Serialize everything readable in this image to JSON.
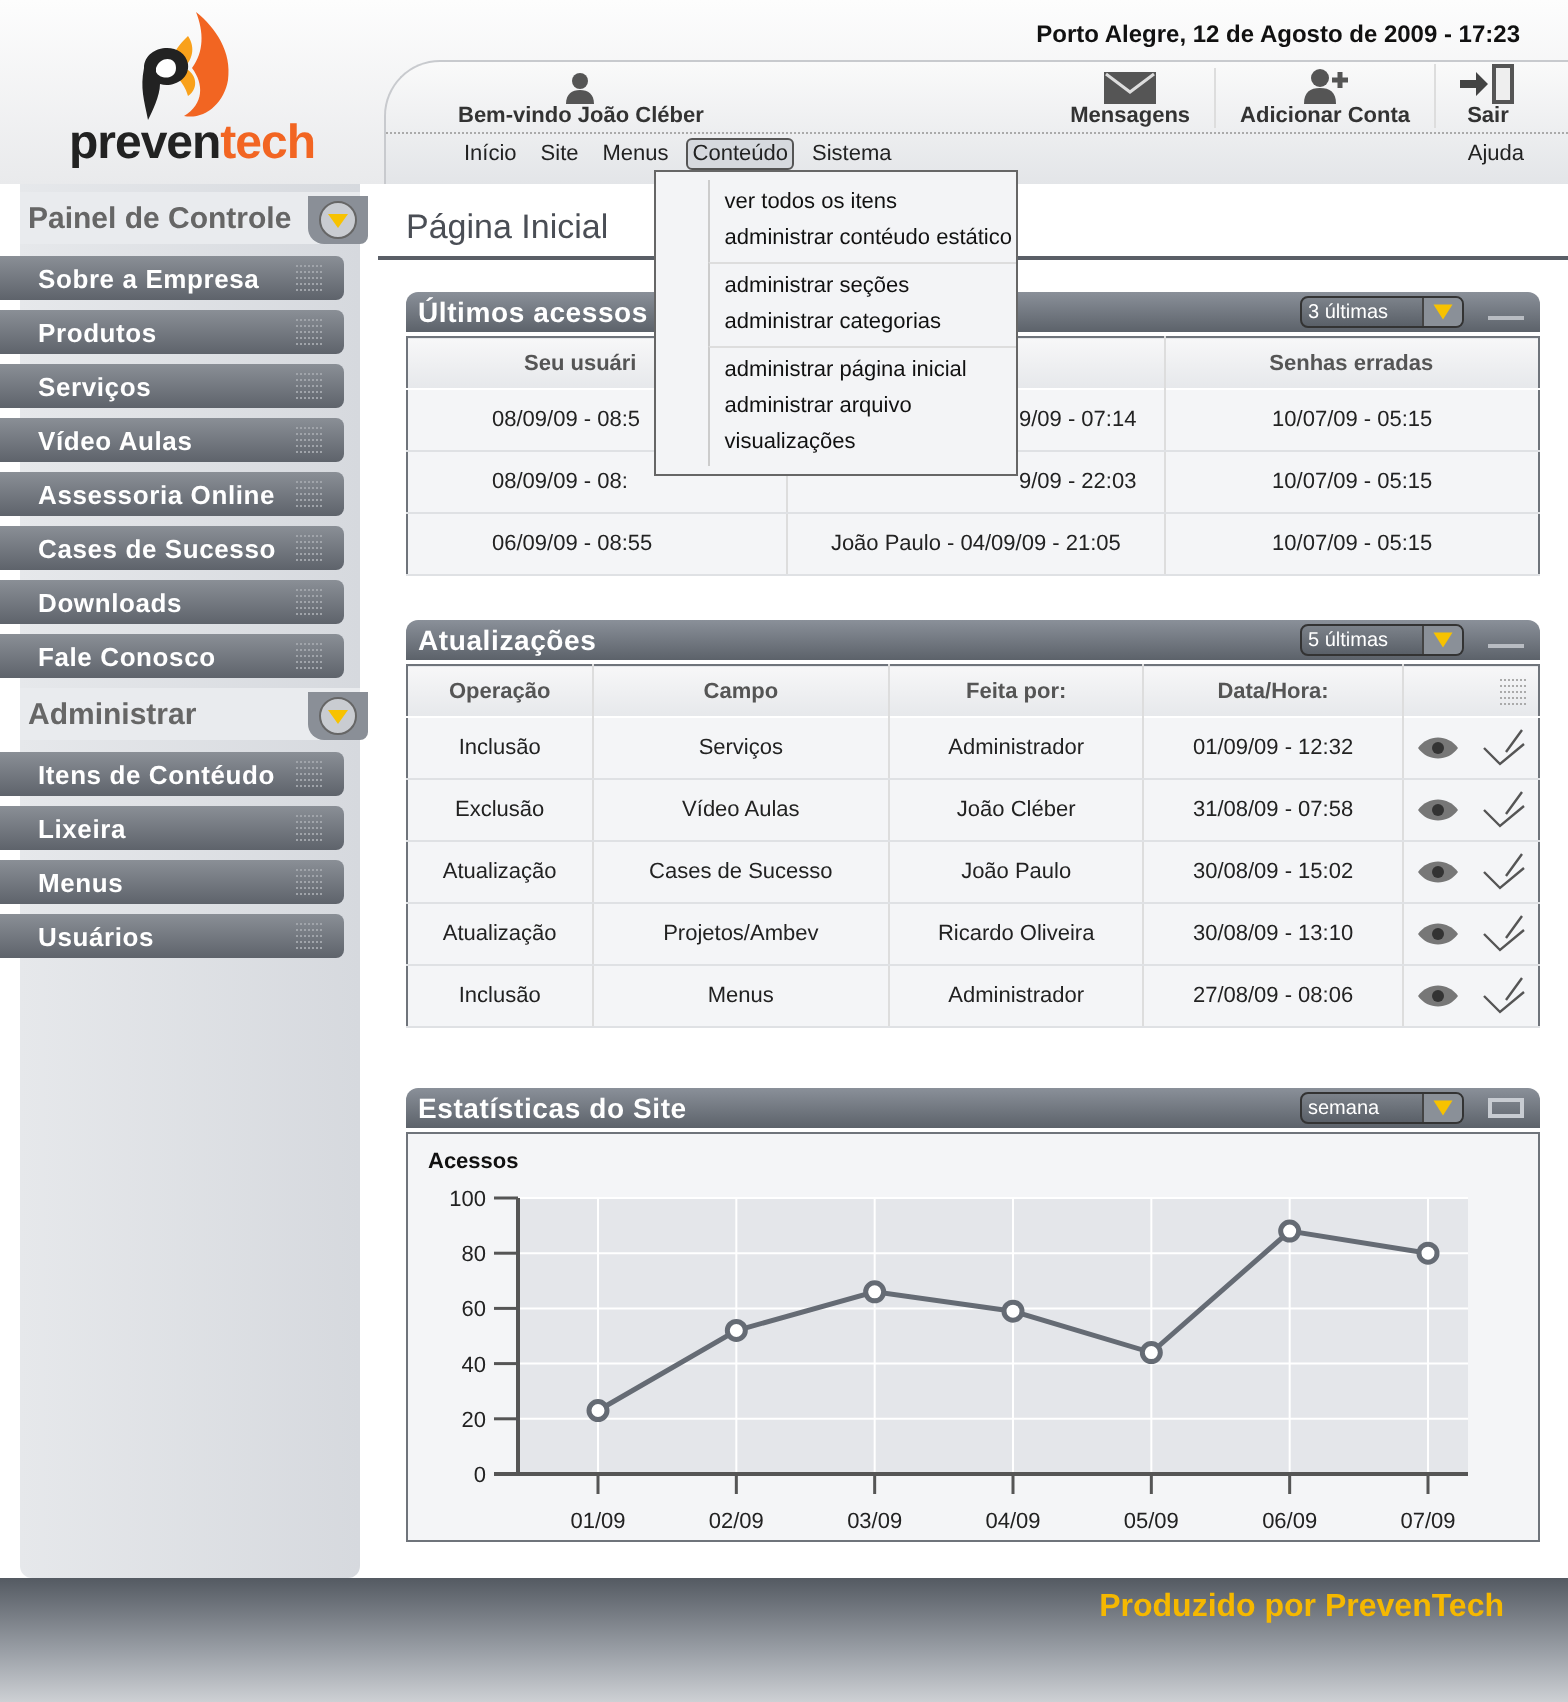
{
  "logo": {
    "part1": "preven",
    "part2": "tech"
  },
  "date": "Porto Alegre, 12 de Agosto de 2009 - 17:23",
  "welcome": "Bem-vindo João Cléber",
  "actions": [
    {
      "kind": "messages",
      "label": "Mensagens"
    },
    {
      "kind": "add_user",
      "label": "Adicionar Conta"
    },
    {
      "kind": "logout",
      "label": "Sair"
    }
  ],
  "nav": [
    {
      "label": "Início",
      "selected": false
    },
    {
      "label": "Site",
      "selected": false
    },
    {
      "label": "Menus",
      "selected": false
    },
    {
      "label": "Conteúdo",
      "selected": true
    },
    {
      "label": "Sistema",
      "selected": false
    }
  ],
  "help": "Ajuda",
  "dropdown": [
    [
      "ver todos os itens",
      "administrar contéudo estático"
    ],
    [
      "administrar seções",
      "administrar categorias"
    ],
    [
      "administrar página inicial",
      "administrar arquivo",
      "visualizações"
    ]
  ],
  "sidebar": [
    {
      "title": "Painel de Controle",
      "items": [
        "Sobre a Empresa",
        "Produtos",
        "Serviços",
        "Vídeo Aulas",
        "Assessoria Online",
        "Cases de Sucesso",
        "Downloads",
        "Fale Conosco"
      ]
    },
    {
      "title": "Administrar",
      "items": [
        "Itens de Contéudo",
        "Lixeira",
        "Menus",
        "Usuários"
      ]
    }
  ],
  "page_title": "Página Inicial",
  "access_panel": {
    "title": "Últimos acessos",
    "select": "3 últimas",
    "columns": [
      "Seu usuári",
      "",
      "Senhas erradas"
    ],
    "rows": [
      [
        "08/09/09 - 08:5",
        "9/09 - 07:14",
        "10/07/09 - 05:15"
      ],
      [
        "08/09/09 - 08:",
        "9/09 - 22:03",
        "10/07/09 - 05:15"
      ],
      [
        "06/09/09 - 08:55",
        "João Paulo - 04/09/09 - 21:05",
        "10/07/09 - 05:15"
      ]
    ]
  },
  "updates_panel": {
    "title": "Atualizações",
    "select": "5 últimas",
    "columns": [
      "Operação",
      "Campo",
      "Feita por:",
      "Data/Hora:"
    ],
    "rows": [
      [
        "Inclusão",
        "Serviços",
        "Administrador",
        "01/09/09 - 12:32"
      ],
      [
        "Exclusão",
        "Vídeo Aulas",
        "João Cléber",
        "31/08/09 - 07:58"
      ],
      [
        "Atualização",
        "Cases de Sucesso",
        "João Paulo",
        "30/08/09 - 15:02"
      ],
      [
        "Atualização",
        "Projetos/Ambev",
        "Ricardo Oliveira",
        "30/08/09 - 13:10"
      ],
      [
        "Inclusão",
        "Menus",
        "Administrador",
        "27/08/09 - 08:06"
      ]
    ]
  },
  "stats_panel": {
    "title": "Estatísticas do Site",
    "select": "semana",
    "chart_data": {
      "type": "line",
      "categories": [
        "01/09",
        "02/09",
        "03/09",
        "04/09",
        "05/09",
        "06/09",
        "07/09"
      ],
      "series": [
        {
          "name": "Acessos",
          "color": "#656b74",
          "marker": "o",
          "values": [
            23,
            52,
            66,
            59,
            44,
            88,
            80
          ]
        }
      ],
      "grid": true,
      "ylim": [
        0,
        100
      ],
      "yticks": [
        0,
        20,
        40,
        60,
        80,
        100
      ]
    }
  },
  "footer": "Produzido por PrevenTech"
}
